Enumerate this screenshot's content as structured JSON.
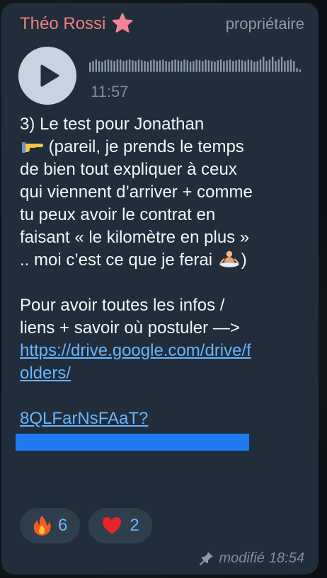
{
  "message": {
    "sender": "Théo Rossi",
    "role": "propriétaire",
    "voice": {
      "duration": "11:57"
    },
    "text": {
      "p1_a": "3) Le test pour Jonathan\n",
      "p1_b": " (pareil, je prends le temps de bien tout expliquer à ceux qui viennent d’arriver + comme tu peux avoir le contrat en faisant « le kilomètre en plus » .. moi c’est ce que je ferai ",
      "p1_c": ")\n\n",
      "p2_a": "Pour avoir toutes les infos / liens + savoir où postuler —> ",
      "link_part1": "https://drive.google.com/drive/folders/",
      "link_part2": "8QLFarNsFAaT?usp=share_link"
    },
    "reactions": [
      {
        "emoji": "fire-emoji",
        "count": "6"
      },
      {
        "emoji": "heart-emoji",
        "count": "2"
      }
    ],
    "footer": {
      "edited_label": "modifié",
      "time": "18:54"
    }
  },
  "colors": {
    "bubble": "#212d3b",
    "sender": "#f07f7f",
    "link": "#67b5ff",
    "reaction_count": "#6cb8ff"
  }
}
